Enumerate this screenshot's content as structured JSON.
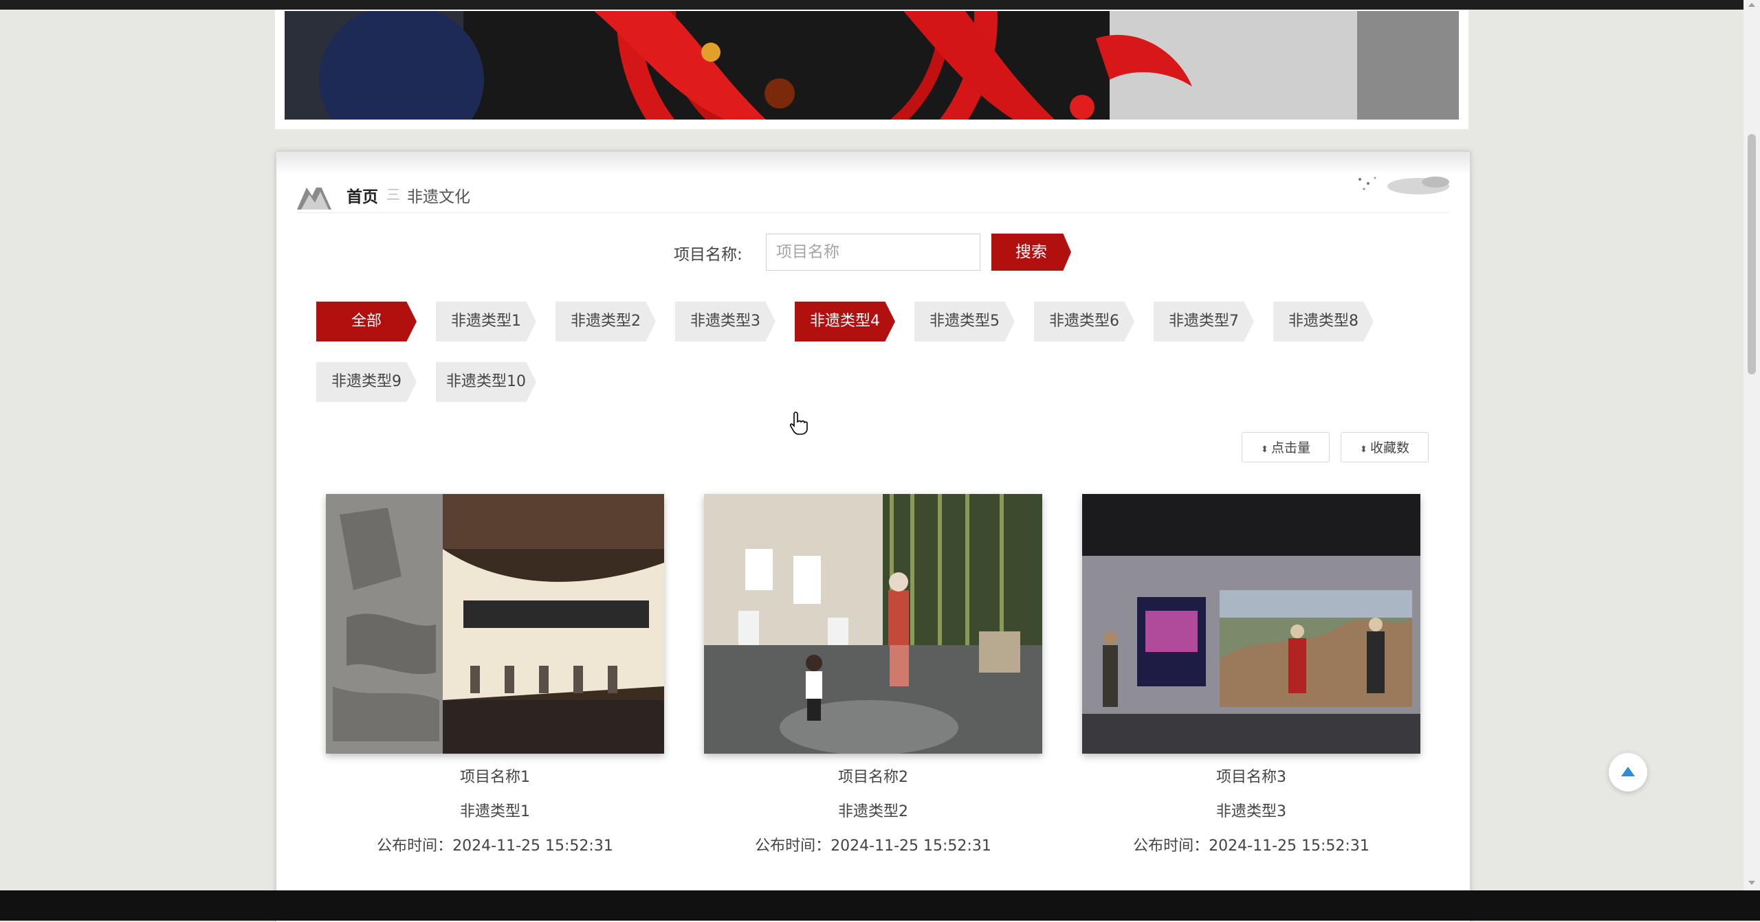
{
  "breadcrumb": {
    "home": "首页",
    "separator": "三",
    "current": "非遗文化"
  },
  "search": {
    "label": "项目名称:",
    "placeholder": "项目名称",
    "value": "",
    "button": "搜索"
  },
  "categories": [
    {
      "label": "全部",
      "active": true
    },
    {
      "label": "非遗类型1",
      "active": false
    },
    {
      "label": "非遗类型2",
      "active": false
    },
    {
      "label": "非遗类型3",
      "active": false
    },
    {
      "label": "非遗类型4",
      "active": true
    },
    {
      "label": "非遗类型5",
      "active": false
    },
    {
      "label": "非遗类型6",
      "active": false
    },
    {
      "label": "非遗类型7",
      "active": false
    },
    {
      "label": "非遗类型8",
      "active": false
    },
    {
      "label": "非遗类型9",
      "active": false
    },
    {
      "label": "非遗类型10",
      "active": false
    }
  ],
  "sort": {
    "clicks": "点击量",
    "favorites": "收藏数",
    "icon": "sort-icon"
  },
  "items": [
    {
      "title": "项目名称1",
      "type": "非遗类型1",
      "time": "公布时间：2024-11-25 15:52:31"
    },
    {
      "title": "项目名称2",
      "type": "非遗类型2",
      "time": "公布时间：2024-11-25 15:52:31"
    },
    {
      "title": "项目名称3",
      "type": "非遗类型3",
      "time": "公布时间：2024-11-25 15:52:31"
    }
  ],
  "colors": {
    "accent": "#b20f0f",
    "tag_bg": "#ebebeb",
    "page_bg": "#e7e7e3"
  },
  "icons": {
    "back_to_top": "arrow-up-icon",
    "breadcrumb": "mountain-icon"
  }
}
